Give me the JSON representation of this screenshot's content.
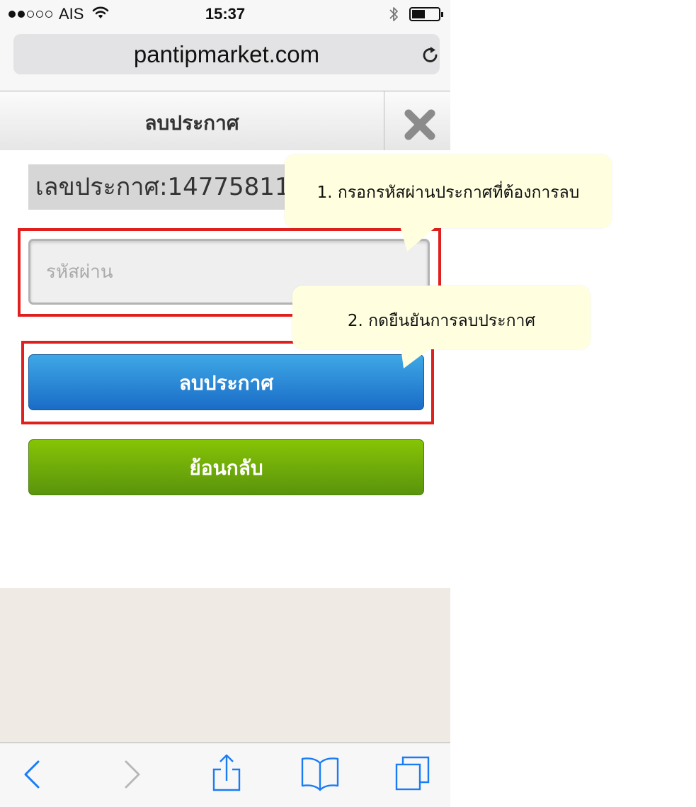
{
  "status_bar": {
    "signal_dots_filled": 2,
    "signal_dots_total": 5,
    "carrier": "AIS",
    "time": "15:37",
    "battery_fraction": 0.5,
    "icons": [
      "wifi-icon",
      "bluetooth-icon",
      "battery-icon"
    ]
  },
  "browser": {
    "url": "pantipmarket.com",
    "reload_icon": "reload-icon"
  },
  "header": {
    "title": "ลบประกาศ",
    "close_icon": "close-icon"
  },
  "form": {
    "announcement_label": "เลขประกาศ:14775811",
    "password_placeholder": "รหัสผ่าน",
    "password_value": "",
    "delete_button": "ลบประกาศ",
    "back_button": "ย้อนกลับ"
  },
  "callouts": {
    "step1": "1. กรอกรหัสผ่านประกาศที่ต้องการลบ",
    "step2": "2. กดยืนยันการลบประกาศ"
  },
  "colors": {
    "highlight_border": "#e01f1f",
    "delete_button": "#1a6cc7",
    "back_button": "#5a940c",
    "callout_background": "#ffffe0",
    "ios_accent": "#1a7cf5"
  },
  "toolbar": {
    "icons": [
      "back-icon",
      "forward-icon",
      "share-icon",
      "bookmarks-icon",
      "tabs-icon"
    ]
  }
}
